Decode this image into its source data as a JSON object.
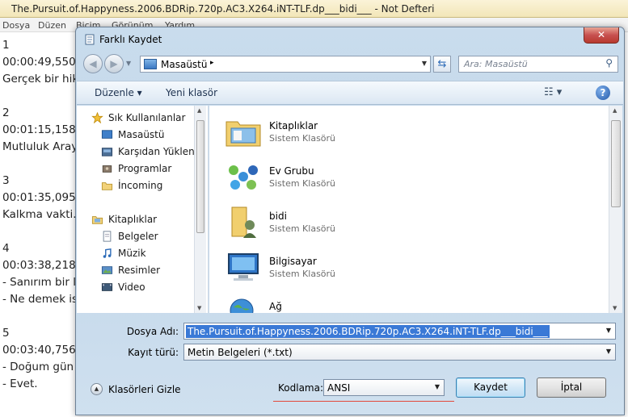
{
  "notepad": {
    "title": "The.Pursuit.of.Happyness.2006.BDRip.720p.AC3.X264.iNT-TLF.dp___bidi___ - Not Defteri",
    "menu": [
      "Dosya",
      "Düzen",
      "Biçim",
      "Görünüm",
      "Yardım"
    ],
    "lines": [
      "1",
      "00:00:49,550",
      "Gerçek bir hik",
      "",
      "2",
      "00:01:15,158",
      "Mutluluk Aray",
      "",
      "3",
      "00:01:35,095",
      "Kalkma vakti.",
      "",
      "4",
      "00:03:38,218",
      "- Sanırım bir li",
      "- Ne demek is",
      "",
      "5",
      "00:03:40,756",
      "- Doğum gün",
      "- Evet."
    ]
  },
  "dialog": {
    "title": "Farklı Kaydet",
    "close": "✕",
    "address": {
      "location": "Masaüstü",
      "separator": "▸"
    },
    "search_placeholder": "Ara: Masaüstü",
    "toolbar": {
      "organize": "Düzenle ▾",
      "new_folder": "Yeni klasör",
      "views": "☷ ▾",
      "help": "?"
    },
    "nav": {
      "favorites_header": "Sık Kullanılanlar",
      "favorites": [
        "Masaüstü",
        "Karşıdan Yüklene",
        "Programlar",
        "İncoming"
      ],
      "libraries_header": "Kitaplıklar",
      "libraries": [
        "Belgeler",
        "Müzik",
        "Resimler",
        "Video"
      ]
    },
    "files": [
      {
        "name": "Kitaplıklar",
        "type": "Sistem Klasörü"
      },
      {
        "name": "Ev Grubu",
        "type": "Sistem Klasörü"
      },
      {
        "name": "bidi",
        "type": "Sistem Klasörü"
      },
      {
        "name": "Bilgisayar",
        "type": "Sistem Klasörü"
      },
      {
        "name": "Ağ",
        "type": ""
      }
    ],
    "filename_label": "Dosya Adı:",
    "filename_value": "The.Pursuit.of.Happyness.2006.BDRip.720p.AC3.X264.iNT-TLF.dp___bidi___",
    "savetype_label": "Kayıt türü:",
    "savetype_value": "Metin Belgeleri (*.txt)",
    "hide_folders": "Klasörleri Gizle",
    "encoding_label": "Kodlama:",
    "encoding_value": "ANSI",
    "save_button": "Kaydet",
    "cancel_button": "İptal"
  }
}
